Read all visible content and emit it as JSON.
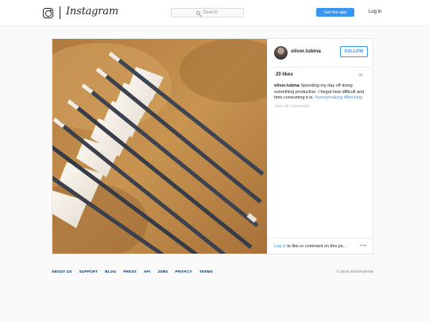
{
  "header": {
    "brand": "Instagram",
    "search_placeholder": "Search",
    "get_app_label": "Get the app",
    "login_label": "Log in"
  },
  "post": {
    "username": "oliver.lubina",
    "follow_label": "FOLLOW",
    "likes": "20 likes",
    "time_ago": "3h",
    "caption_user": "oliver.lubina",
    "caption_text": "Spending my day off doing something productive. I forgot how difficult and time consuming it is.",
    "hashtags": [
      "#arrowmaking",
      "#fletching"
    ],
    "view_all_comments": "view all comments",
    "login_link": "Log in",
    "login_to_comment_text": "to like or comment on this po...",
    "more_glyph": "•••",
    "photo_subject": "wooden arrows with white fletching",
    "icons": {
      "logo": "instagram-camera-icon",
      "search": "search-icon",
      "more": "more-options-icon"
    }
  },
  "footer": {
    "links": [
      "ABOUT US",
      "SUPPORT",
      "BLOG",
      "PRESS",
      "API",
      "JOBS",
      "PRIVACY",
      "TERMS"
    ],
    "copyright": "© 2016 INSTAGRAM"
  },
  "colors": {
    "accent": "#3897f0",
    "page_bg": "#fafafa",
    "footer_link": "#003569"
  }
}
